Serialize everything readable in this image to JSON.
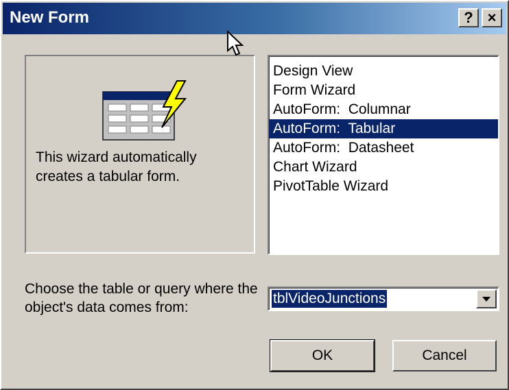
{
  "window": {
    "title": "New Form",
    "help_label": "?",
    "close_label": "×"
  },
  "preview": {
    "icon": "tabular-form-wizard-icon",
    "description": "This wizard automatically creates a tabular form."
  },
  "form_types": {
    "items": [
      "Design View",
      "Form Wizard",
      "AutoForm:  Columnar",
      "AutoForm:  Tabular",
      "AutoForm:  Datasheet",
      "Chart Wizard",
      "PivotTable Wizard"
    ],
    "selected": "AutoForm:  Tabular"
  },
  "source": {
    "prompt": "Choose the table or query where the object's data comes from:",
    "value": "tblVideoJunctions"
  },
  "buttons": {
    "ok": "OK",
    "cancel": "Cancel"
  },
  "colors": {
    "title_gradient_start": "#0a246a",
    "title_gradient_end": "#a6caf0",
    "selection": "#0a246a",
    "face": "#d4d0c8"
  }
}
